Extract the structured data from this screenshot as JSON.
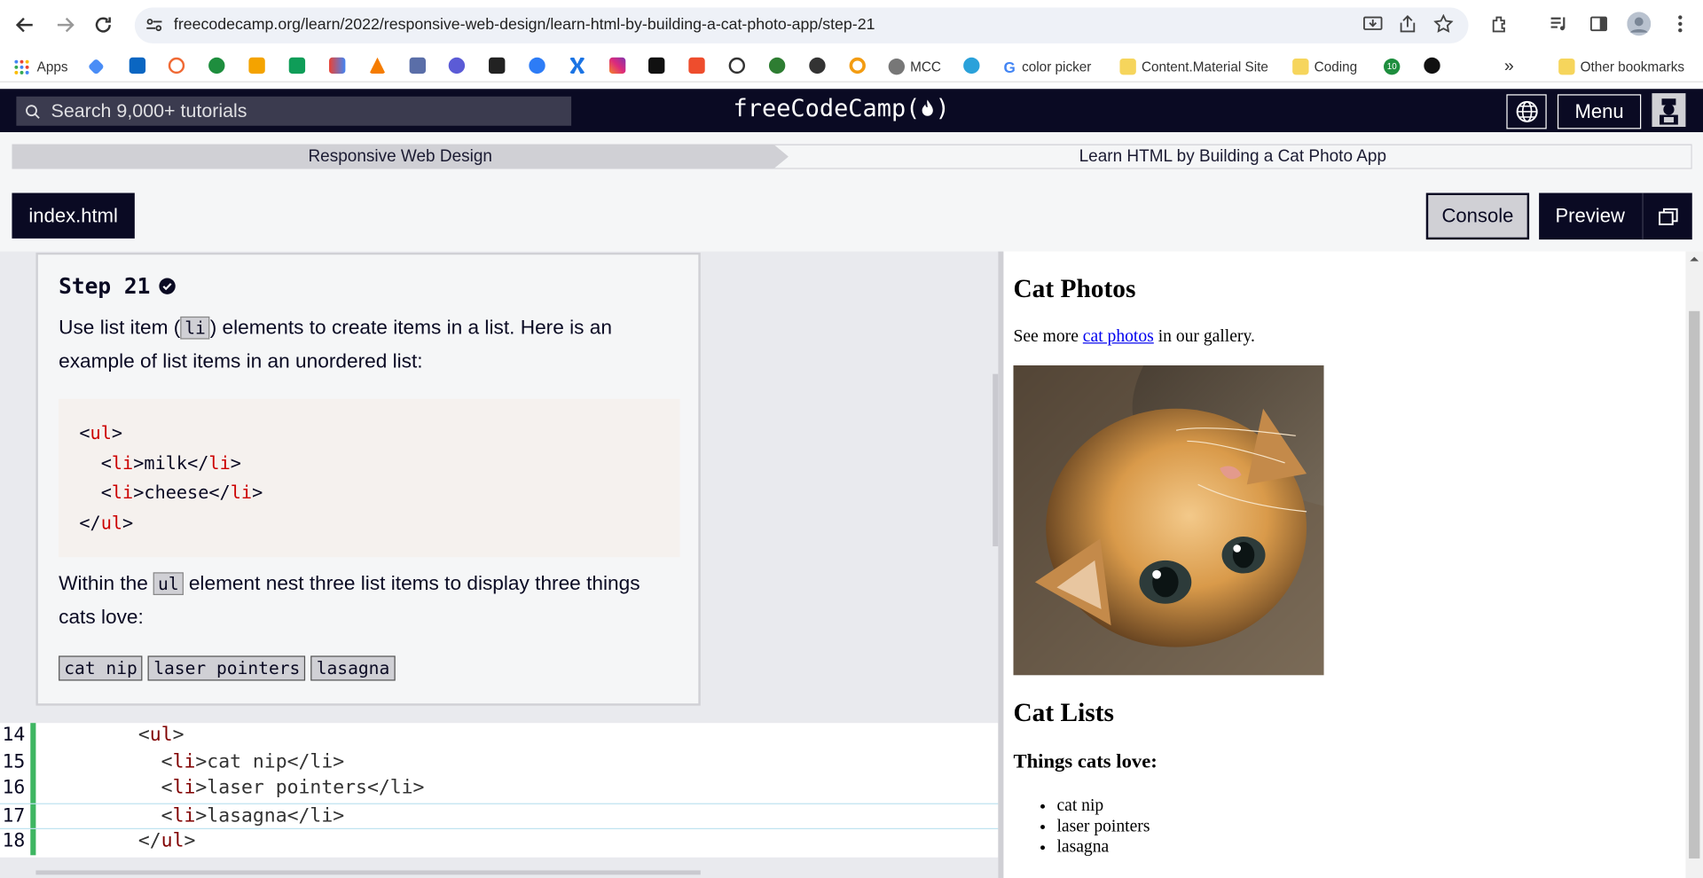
{
  "browser": {
    "url": "freecodecamp.org/learn/2022/responsive-web-design/learn-html-by-building-a-cat-photo-app/step-21",
    "bookmarks": {
      "apps": "Apps",
      "mcc": "MCC",
      "color_picker": "color picker",
      "content_material": "Content.Material Site",
      "coding": "Coding",
      "badge_10": "10",
      "more": "»",
      "other": "Other bookmarks"
    }
  },
  "fcc_nav": {
    "search_placeholder": "Search 9,000+ tutorials",
    "logo": "freeCodeCamp(",
    "logo_end": ")",
    "menu_label": "Menu"
  },
  "breadcrumb": {
    "superblock": "Responsive Web Design",
    "block": "Learn HTML by Building a Cat Photo App"
  },
  "toolbar": {
    "file_tab": "index.html",
    "console_label": "Console",
    "preview_label": "Preview"
  },
  "step": {
    "title": "Step 21",
    "desc1_a": "Use list item (",
    "desc1_code": "li",
    "desc1_b": ") elements to create items in a list. Here is an example of list items in an unordered list:",
    "example_lines": {
      "l1_tag": "ul",
      "l2_tag": "li",
      "l2_text": "milk",
      "l3_tag": "li",
      "l3_text": "cheese",
      "l4_tag": "ul"
    },
    "desc2_a": "Within the ",
    "desc2_code": "ul",
    "desc2_b": " element nest three list items to display three things cats love:",
    "chips": [
      "cat nip",
      "laser pointers",
      "lasagna"
    ]
  },
  "editor": {
    "lines": [
      {
        "num": "14",
        "indent": "        ",
        "before": "<",
        "tag": "ul",
        "after": ">",
        "text": "",
        "close": ""
      },
      {
        "num": "15",
        "indent": "          ",
        "before": "<",
        "tag": "li",
        "after": ">",
        "text": "cat nip",
        "close": "</li>"
      },
      {
        "num": "16",
        "indent": "          ",
        "before": "<",
        "tag": "li",
        "after": ">",
        "text": "laser pointers",
        "close": "</li>"
      },
      {
        "num": "17",
        "indent": "          ",
        "before": "<",
        "tag": "li",
        "after": ">",
        "text": "lasagna",
        "close": "</li>"
      },
      {
        "num": "18",
        "indent": "        ",
        "before": "</",
        "tag": "ul",
        "after": ">",
        "text": "",
        "close": ""
      }
    ]
  },
  "preview": {
    "h1": "Cat Photos",
    "p_before": "See more ",
    "p_link": "cat photos",
    "p_after": " in our gallery.",
    "h2": "Cat Lists",
    "h3": "Things cats love:",
    "items": [
      "cat nip",
      "laser pointers",
      "lasagna"
    ]
  },
  "colors": {
    "nav_bg": "#0a0a23",
    "gutter_green": "#3eb662",
    "tag_red": "#cc0000"
  }
}
